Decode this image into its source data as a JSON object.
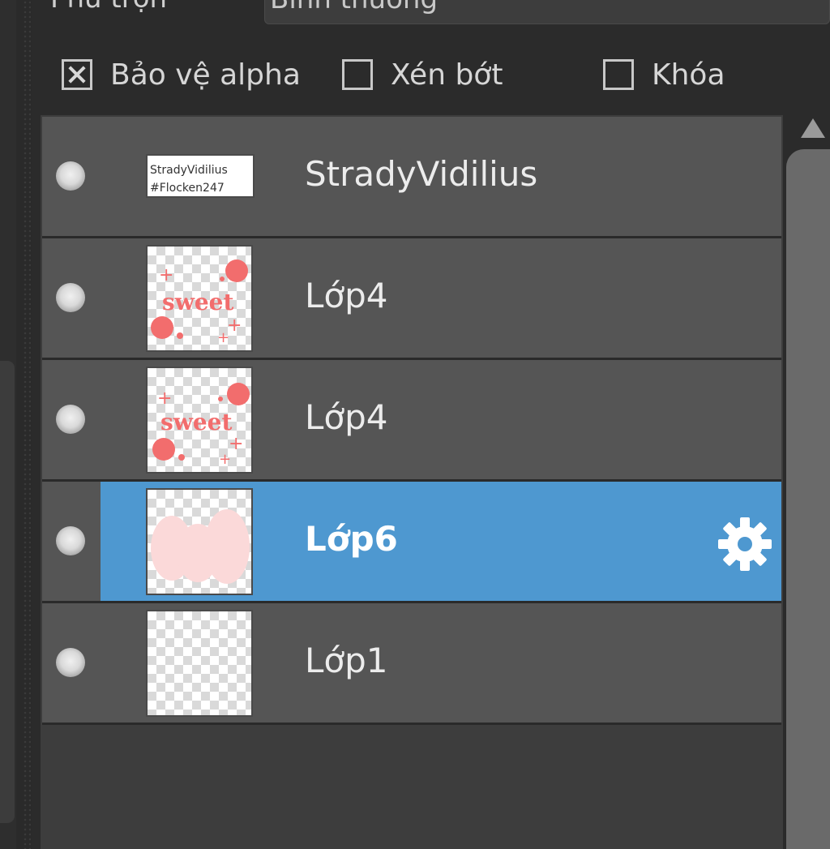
{
  "blend": {
    "label": "Phủ trộn",
    "value": "Bình thường"
  },
  "options": [
    {
      "label": "Bảo vệ alpha",
      "checked": true
    },
    {
      "label": "Xén bớt",
      "checked": false
    },
    {
      "label": "Khóa",
      "checked": false
    }
  ],
  "layers": [
    {
      "name": "StradyVidilius",
      "visible": true,
      "selected": false,
      "thumbnail_text": [
        "StradyVidilius",
        "#Flocken247"
      ]
    },
    {
      "name": "Lớp4",
      "visible": true,
      "selected": false,
      "thumbnail_text": [
        "sweet"
      ]
    },
    {
      "name": "Lớp4",
      "visible": true,
      "selected": false,
      "thumbnail_text": [
        "sweet"
      ]
    },
    {
      "name": "Lớp6",
      "visible": true,
      "selected": true
    },
    {
      "name": "Lớp1",
      "visible": true,
      "selected": false
    }
  ],
  "colors": {
    "selected_row": "#4e98d0",
    "row": "#555555",
    "panel": "#2b2b2b",
    "sticker_pink": "#f26d6d"
  },
  "icons": {
    "layer_settings": "gear-icon",
    "visibility": "eye-dot-icon",
    "scroll_up": "triangle-up-icon"
  }
}
